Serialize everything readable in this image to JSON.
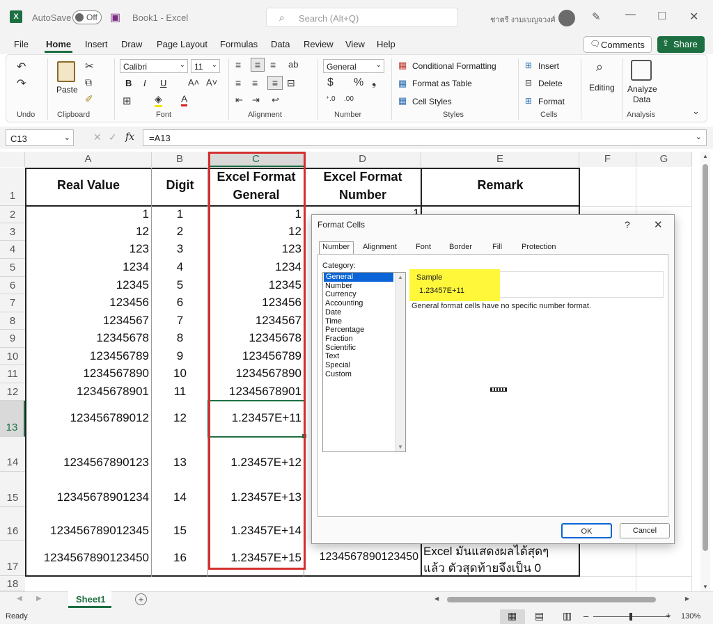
{
  "title_bar": {
    "autosave_label": "AutoSave",
    "toggle_state": "Off",
    "doc_title": "Book1  -  Excel",
    "search_placeholder": "Search (Alt+Q)",
    "user_name": "ชาตรี งามเบญจวงศ์"
  },
  "menu": {
    "tabs": [
      "File",
      "Home",
      "Insert",
      "Draw",
      "Page Layout",
      "Formulas",
      "Data",
      "Review",
      "View",
      "Help"
    ],
    "comments": "Comments",
    "share": "Share"
  },
  "ribbon": {
    "undo_group": "Undo",
    "paste": "Paste",
    "clipboard_group": "Clipboard",
    "font_name": "Calibri",
    "font_size": "11",
    "font_group": "Font",
    "bold": "B",
    "italic": "I",
    "underline": "U",
    "alignment_group": "Alignment",
    "number_format": "General",
    "number_group": "Number",
    "cond_format": "Conditional Formatting",
    "format_table": "Format as Table",
    "cell_styles": "Cell Styles",
    "styles_group": "Styles",
    "insert": "Insert",
    "delete": "Delete",
    "format": "Format",
    "cells_group": "Cells",
    "editing": "Editing",
    "analyze": "Analyze",
    "analyze2": "Data",
    "analysis_group": "Analysis"
  },
  "formula_bar": {
    "name_box": "C13",
    "fx": "fx",
    "formula": "=A13"
  },
  "columns": [
    "A",
    "B",
    "C",
    "D",
    "E",
    "F",
    "G"
  ],
  "rows": [
    "1",
    "2",
    "3",
    "4",
    "5",
    "6",
    "7",
    "8",
    "9",
    "10",
    "11",
    "12",
    "13",
    "14",
    "15",
    "16",
    "17",
    "18"
  ],
  "headers": {
    "a": "Real Value",
    "b": "Digit",
    "c1": "Excel Format",
    "c2": "General",
    "d1": "Excel Format",
    "d2": "Number",
    "e": "Remark"
  },
  "table": [
    {
      "a": "1",
      "b": "1",
      "c": "1",
      "d": "1"
    },
    {
      "a": "12",
      "b": "2",
      "c": "12",
      "d": ""
    },
    {
      "a": "123",
      "b": "3",
      "c": "123",
      "d": ""
    },
    {
      "a": "1234",
      "b": "4",
      "c": "1234",
      "d": ""
    },
    {
      "a": "12345",
      "b": "5",
      "c": "12345",
      "d": ""
    },
    {
      "a": "123456",
      "b": "6",
      "c": "123456",
      "d": ""
    },
    {
      "a": "1234567",
      "b": "7",
      "c": "1234567",
      "d": ""
    },
    {
      "a": "12345678",
      "b": "8",
      "c": "12345678",
      "d": ""
    },
    {
      "a": "123456789",
      "b": "9",
      "c": "123456789",
      "d": ""
    },
    {
      "a": "1234567890",
      "b": "10",
      "c": "1234567890",
      "d": ""
    },
    {
      "a": "12345678901",
      "b": "11",
      "c": "12345678901",
      "d": ""
    },
    {
      "a": "123456789012",
      "b": "12",
      "c": "1.23457E+11",
      "d": ""
    },
    {
      "a": "1234567890123",
      "b": "13",
      "c": "1.23457E+12",
      "d": ""
    },
    {
      "a": "12345678901234",
      "b": "14",
      "c": "1.23457E+13",
      "d": ""
    },
    {
      "a": "123456789012345",
      "b": "15",
      "c": "1.23457E+14",
      "d": ""
    },
    {
      "a": "1234567890123450",
      "b": "16",
      "c": "1.23457E+15",
      "d": "1234567890123450"
    }
  ],
  "remark": {
    "line1": "Excel มันแสดงผลได้สุดๆ",
    "line2": "แล้ว ตัวสุดท้ายจึงเป็น 0"
  },
  "dialog": {
    "title": "Format Cells",
    "help": "?",
    "tabs": [
      "Number",
      "Alignment",
      "Font",
      "Border",
      "Fill",
      "Protection"
    ],
    "category_label": "Category:",
    "categories": [
      "General",
      "Number",
      "Currency",
      "Accounting",
      "Date",
      "Time",
      "Percentage",
      "Fraction",
      "Scientific",
      "Text",
      "Special",
      "Custom"
    ],
    "sample_label": "Sample",
    "sample_value": "1.23457E+11",
    "description": "General format cells have no specific number format.",
    "ok": "OK",
    "cancel": "Cancel"
  },
  "sheet_tab": "Sheet1",
  "status": {
    "ready": "Ready",
    "zoom": "130%"
  }
}
